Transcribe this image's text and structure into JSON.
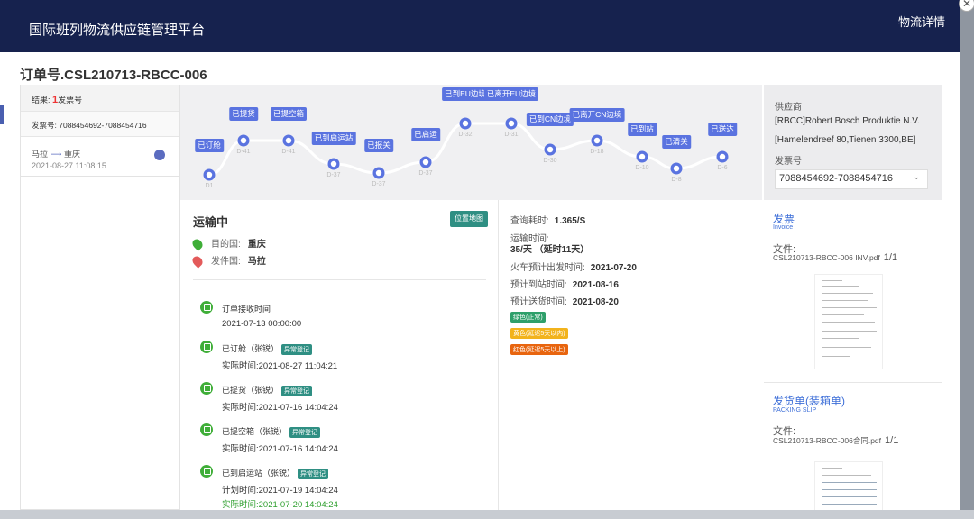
{
  "header": {
    "title": "国际班列物流供应链管理平台",
    "right_label": "物流详情"
  },
  "order_no": "订单号.CSL210713-RBCC-006",
  "left": {
    "result_label": "结果:",
    "result_count": "1",
    "result_unit": "发票号",
    "bill_label": "发票号:",
    "bill_value": "7088454692-7088454716",
    "route_from": "马拉",
    "route_arrow": "⟶",
    "route_to": "重庆",
    "route_date": "2021-08-27 11:08:15"
  },
  "timeline": [
    {
      "label": "已订舱",
      "day": "D1"
    },
    {
      "label": "已提货",
      "day": "D-41"
    },
    {
      "label": "已提空箱",
      "day": "D-41"
    },
    {
      "label": "已到启运站",
      "day": "D-37"
    },
    {
      "label": "已报关",
      "day": "D-37"
    },
    {
      "label": "已启运",
      "day": "D-37"
    },
    {
      "label": "已到EU边境",
      "day": "D-32"
    },
    {
      "label": "已离开EU边境",
      "day": "D-31"
    },
    {
      "label": "已到CN边境",
      "day": "D-30"
    },
    {
      "label": "已离开CN边境",
      "day": "D-18"
    },
    {
      "label": "已到站",
      "day": "D-10"
    },
    {
      "label": "已清关",
      "day": "D-8"
    },
    {
      "label": "已送达",
      "day": "D-6"
    }
  ],
  "status": {
    "title": "运输中",
    "locate_btn": "位置地图",
    "dest_label": "目的国:",
    "dest_value": "重庆",
    "origin_label": "发件国:",
    "origin_value": "马拉"
  },
  "events": [
    {
      "title": "订单接收时间",
      "tag": "",
      "line2": "2021-07-13 00:00:00"
    },
    {
      "title": "已订舱（张锐）",
      "tag": "异常登记",
      "line2": "实际时间:2021-08-27 11:04:21"
    },
    {
      "title": "已提货（张锐）",
      "tag": "异常登记",
      "line2": "实际时间:2021-07-16 14:04:24"
    },
    {
      "title": "已提空箱（张锐）",
      "tag": "异常登记",
      "line2": "实际时间:2021-07-16 14:04:24"
    },
    {
      "title": "已到启运站（张锐）",
      "tag": "异常登记",
      "line2": "计划时间:2021-07-19 14:04:24",
      "line3": "实际时间:2021-07-20 14:04:24"
    }
  ],
  "info": {
    "query_label": "查询耗时:",
    "query_value": "1.365/S",
    "transit_label": "运输时间:",
    "transit_value": "35/天 （延时11天）",
    "depart_label": "火车预计出发时间:",
    "depart_value": "2021-07-20",
    "arrive_label": "预计到站时间:",
    "arrive_value": "2021-08-16",
    "deliver_label": "预计送货时间:",
    "deliver_value": "2021-08-20",
    "legend": [
      "绿色(正常)",
      "黄色(延迟5天以内)",
      "红色(延迟5天以上)"
    ],
    "legend_colors": [
      "#2e9f6a",
      "#f2b31c",
      "#e8650f"
    ]
  },
  "right": {
    "supplier_label": "供应商",
    "supplier_name": "[RBCC]Robert Bosch Produktie N.V.",
    "supplier_addr": "[Hamelendreef 80,Tienen 3300,BE]",
    "bill_label": "发票号",
    "bill_value": "7088454692-7088454716",
    "docs": [
      {
        "title": "发票",
        "subtitle": "Invoice",
        "file_label": "文件:",
        "file_name": "CSL210713-RBCC-006 INV.pdf",
        "pages": "1/1"
      },
      {
        "title": "发货单(装箱单)",
        "subtitle": "PACKING SLIP",
        "file_label": "文件:",
        "file_name": "CSL210713-RBCC-006合同.pdf",
        "pages": "1/1"
      }
    ]
  }
}
